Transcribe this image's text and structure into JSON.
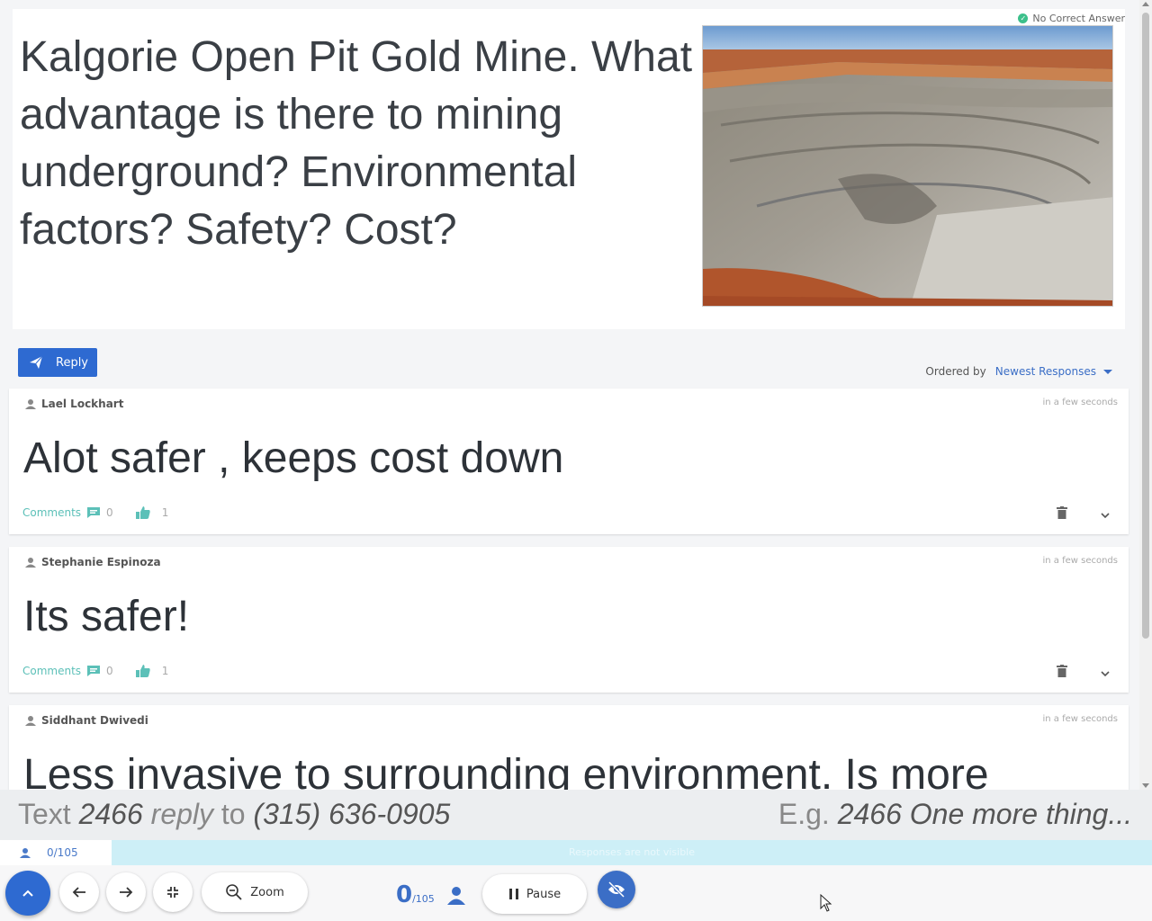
{
  "question": {
    "text": "Kalgorie Open Pit Gold Mine.  What advantage is there to mining underground?  Environmental factors? Safety? Cost?",
    "no_correct_answer": "No Correct Answer",
    "image_icon": "open-pit-mine-photo"
  },
  "reply": {
    "label": "Reply",
    "icon": "send-icon"
  },
  "ordering": {
    "label": "Ordered by",
    "selected": "Newest Responses"
  },
  "responses": [
    {
      "author": "Lael Lockhart",
      "time": "in a few seconds",
      "body": "Alot safer , keeps cost down",
      "comments_label": "Comments",
      "comments_count": "0",
      "likes": "1"
    },
    {
      "author": "Stephanie Espinoza",
      "time": "in a few seconds",
      "body": "Its safer!",
      "comments_label": "Comments",
      "comments_count": "0",
      "likes": "1"
    },
    {
      "author": "Siddhant Dwivedi",
      "time": "in a few seconds",
      "body": "Less invasive to surrounding environment. Is more"
    }
  ],
  "sms": {
    "text_word": "Text",
    "code": "2466",
    "reply_word": "reply",
    "to_word": "to",
    "phone": "(315) 636-0905",
    "eg_word": "E.g.",
    "example": "2466 One more thing..."
  },
  "status": {
    "count": "0/105",
    "banner": "Responses are not visible"
  },
  "toolbar": {
    "zoom_label": "Zoom",
    "response_count": "0",
    "response_total": "/105",
    "pause_label": "Pause"
  },
  "colors": {
    "accent": "#2e6ad1",
    "teal": "#5cc0b8",
    "banner": "#cdeff7"
  }
}
